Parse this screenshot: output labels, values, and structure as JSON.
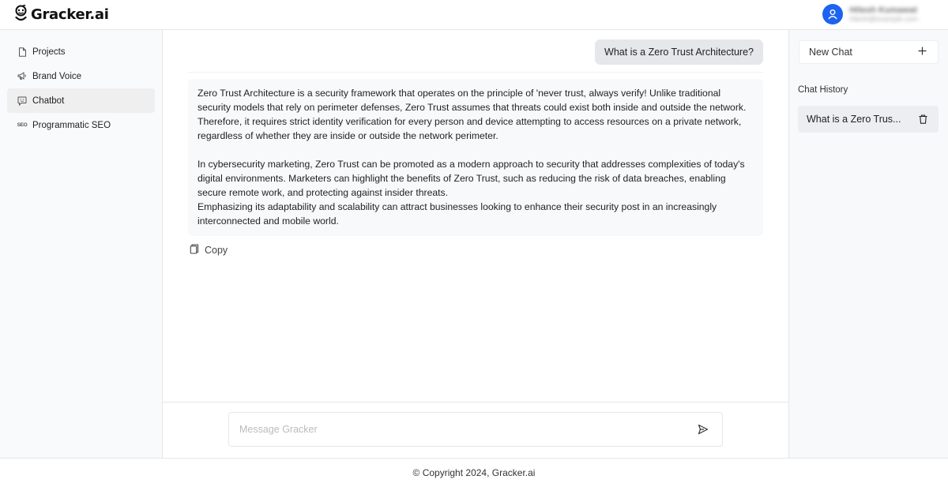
{
  "header": {
    "brand": "Gracker.ai",
    "user_name": "Hitesh Kumawat",
    "user_email": "hitesh@example.com"
  },
  "sidebar": {
    "items": [
      {
        "label": "Projects",
        "icon": "file-icon",
        "active": false
      },
      {
        "label": "Brand Voice",
        "icon": "megaphone-icon",
        "active": false
      },
      {
        "label": "Chatbot",
        "icon": "chat-bubble-icon",
        "active": true
      },
      {
        "label": "Programmatic SEO",
        "icon": "seo-icon",
        "active": false,
        "glyph": "SEO"
      }
    ]
  },
  "chat": {
    "user_message": "What is a Zero Trust Architecture?",
    "answer_paragraphs": [
      "Zero Trust Architecture is a security framework that operates on the principle of 'never trust, always verify! Unlike traditional security models that rely on perimeter defenses, Zero Trust assumes that threats could exist both inside and outside the network. Therefore, it requires strict identity verification for every person and device attempting to access resources on a private network, regardless of whether they are inside or outside the network perimeter.",
      "In cybersecurity marketing, Zero Trust can be promoted as a modern approach to security that addresses complexities of today's digital environments. Marketers can highlight the benefits of Zero Trust, such as reducing the risk of data breaches, enabling secure remote work, and protecting against insider threats.\nEmphasizing its adaptability and scalability can attract businesses looking to enhance their security post in an increasingly interconnected and mobile world."
    ],
    "copy_label": "Copy",
    "input_placeholder": "Message Gracker",
    "input_value": ""
  },
  "right_panel": {
    "new_chat_label": "New Chat",
    "history_label": "Chat History",
    "history_items": [
      {
        "title": "What is a Zero Trus..."
      }
    ]
  },
  "footer": {
    "text": "© Copyright 2024, Gracker.ai"
  },
  "colors": {
    "accent": "#1d63f0",
    "active_nav": "#efefef",
    "user_bubble": "#e5e7eb"
  }
}
